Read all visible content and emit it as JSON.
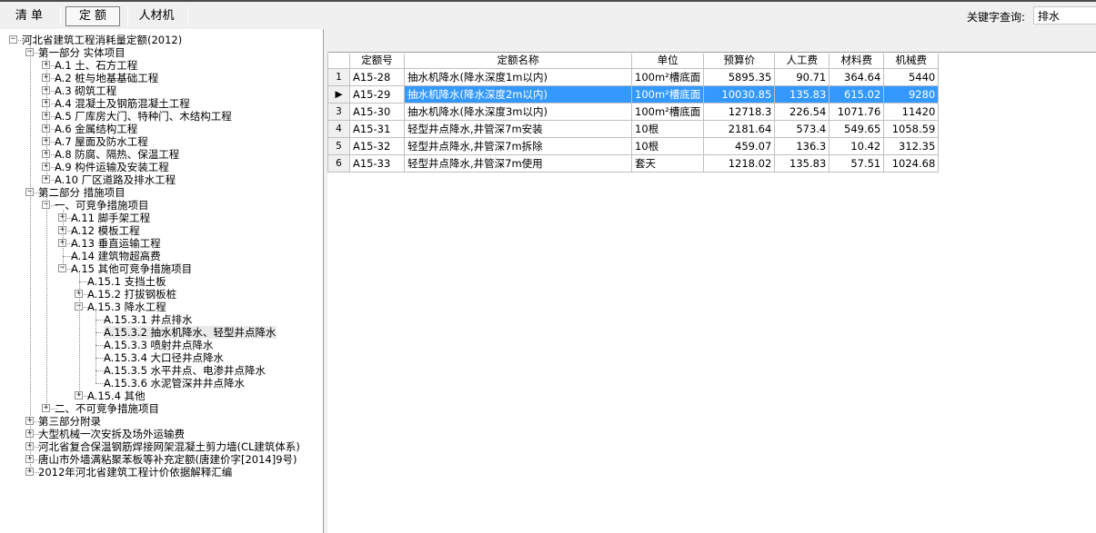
{
  "toolbar": {
    "tabs": [
      {
        "label": "清 单"
      },
      {
        "label": "定 额"
      },
      {
        "label": "人材机"
      }
    ],
    "active_tab": "定 额",
    "keyword_label": "关键字查询:",
    "keyword_value": "排水"
  },
  "tree": {
    "items": [
      {
        "label": "河北省建筑工程消耗量定额(2012)",
        "level": 0,
        "expander": "-"
      },
      {
        "label": "第一部分 实体项目",
        "level": 1,
        "expander": "-"
      },
      {
        "label": "A.1 土、石方工程",
        "level": 2,
        "expander": "+"
      },
      {
        "label": "A.2 桩与地基基础工程",
        "level": 2,
        "expander": "+"
      },
      {
        "label": "A.3 砌筑工程",
        "level": 2,
        "expander": "+"
      },
      {
        "label": "A.4 混凝土及钢筋混凝土工程",
        "level": 2,
        "expander": "+"
      },
      {
        "label": "A.5 厂库房大门、特种门、木结构工程",
        "level": 2,
        "expander": "+"
      },
      {
        "label": "A.6 金属结构工程",
        "level": 2,
        "expander": "+"
      },
      {
        "label": "A.7 屋面及防水工程",
        "level": 2,
        "expander": "+"
      },
      {
        "label": "A.8 防腐、隔热、保温工程",
        "level": 2,
        "expander": "+"
      },
      {
        "label": "A.9 构件运输及安装工程",
        "level": 2,
        "expander": "+"
      },
      {
        "label": "A.10 厂区道路及排水工程",
        "level": 2,
        "expander": "+"
      },
      {
        "label": "第二部分 措施项目",
        "level": 1,
        "expander": "-"
      },
      {
        "label": "一、可竞争措施项目",
        "level": 2,
        "expander": "-"
      },
      {
        "label": "A.11 脚手架工程",
        "level": 3,
        "expander": "+"
      },
      {
        "label": "A.12 模板工程",
        "level": 3,
        "expander": "+"
      },
      {
        "label": "A.13 垂直运输工程",
        "level": 3,
        "expander": "+"
      },
      {
        "label": "A.14 建筑物超高费",
        "level": 3,
        "expander": ""
      },
      {
        "label": "A.15 其他可竞争措施项目",
        "level": 3,
        "expander": "-"
      },
      {
        "label": "A.15.1 支挡土板",
        "level": 4,
        "expander": ""
      },
      {
        "label": "A.15.2 打拔钢板桩",
        "level": 4,
        "expander": "+"
      },
      {
        "label": "A.15.3 降水工程",
        "level": 4,
        "expander": "-"
      },
      {
        "label": "A.15.3.1 井点排水",
        "level": 5,
        "expander": ""
      },
      {
        "label": "A.15.3.2 抽水机降水、轻型井点降水",
        "level": 5,
        "expander": "",
        "selected": true
      },
      {
        "label": "A.15.3.3 喷射井点降水",
        "level": 5,
        "expander": ""
      },
      {
        "label": "A.15.3.4 大口径井点降水",
        "level": 5,
        "expander": ""
      },
      {
        "label": "A.15.3.5 水平井点、电渗井点降水",
        "level": 5,
        "expander": ""
      },
      {
        "label": "A.15.3.6 水泥管深井井点降水",
        "level": 5,
        "expander": ""
      },
      {
        "label": "A.15.4 其他",
        "level": 4,
        "expander": "+"
      },
      {
        "label": "二、不可竞争措施项目",
        "level": 2,
        "expander": "+"
      },
      {
        "label": "第三部分附录",
        "level": 1,
        "expander": "+"
      },
      {
        "label": "大型机械一次安拆及场外运输费",
        "level": 1,
        "expander": "+"
      },
      {
        "label": "河北省复合保温钢筋焊接网架混凝土剪力墙(CL建筑体系)",
        "level": 1,
        "expander": "+"
      },
      {
        "label": "唐山市外墙满粘聚苯板等补充定额(唐建价字[2014]9号)",
        "level": 1,
        "expander": "+"
      },
      {
        "label": "2012年河北省建筑工程计价依据解释汇编",
        "level": 1,
        "expander": "+"
      }
    ]
  },
  "grid": {
    "columns": [
      "定额号",
      "定额名称",
      "单位",
      "预算价",
      "人工费",
      "材料费",
      "机械费"
    ],
    "rows": [
      {
        "no": "1",
        "code": "A15-28",
        "name": "抽水机降水(降水深度1m以内)",
        "unit": "100m²槽底面",
        "price": "5895.35",
        "labor": "90.71",
        "material": "364.64",
        "machine": "5440"
      },
      {
        "no": "2",
        "code": "A15-29",
        "name": "抽水机降水(降水深度2m以内)",
        "unit": "100m²槽底面",
        "price": "10030.85",
        "labor": "135.83",
        "material": "615.02",
        "machine": "9280",
        "selected": true
      },
      {
        "no": "3",
        "code": "A15-30",
        "name": "抽水机降水(降水深度3m以内)",
        "unit": "100m²槽底面",
        "price": "12718.3",
        "labor": "226.54",
        "material": "1071.76",
        "machine": "11420"
      },
      {
        "no": "4",
        "code": "A15-31",
        "name": "轻型井点降水,井管深7m安装",
        "unit": "10根",
        "price": "2181.64",
        "labor": "573.4",
        "material": "549.65",
        "machine": "1058.59"
      },
      {
        "no": "5",
        "code": "A15-32",
        "name": "轻型井点降水,井管深7m拆除",
        "unit": "10根",
        "price": "459.07",
        "labor": "136.3",
        "material": "10.42",
        "machine": "312.35"
      },
      {
        "no": "6",
        "code": "A15-33",
        "name": "轻型井点降水,井管深7m使用",
        "unit": "套天",
        "price": "1218.02",
        "labor": "135.83",
        "material": "57.51",
        "machine": "1024.68"
      }
    ],
    "current_row_marker": "▶"
  }
}
